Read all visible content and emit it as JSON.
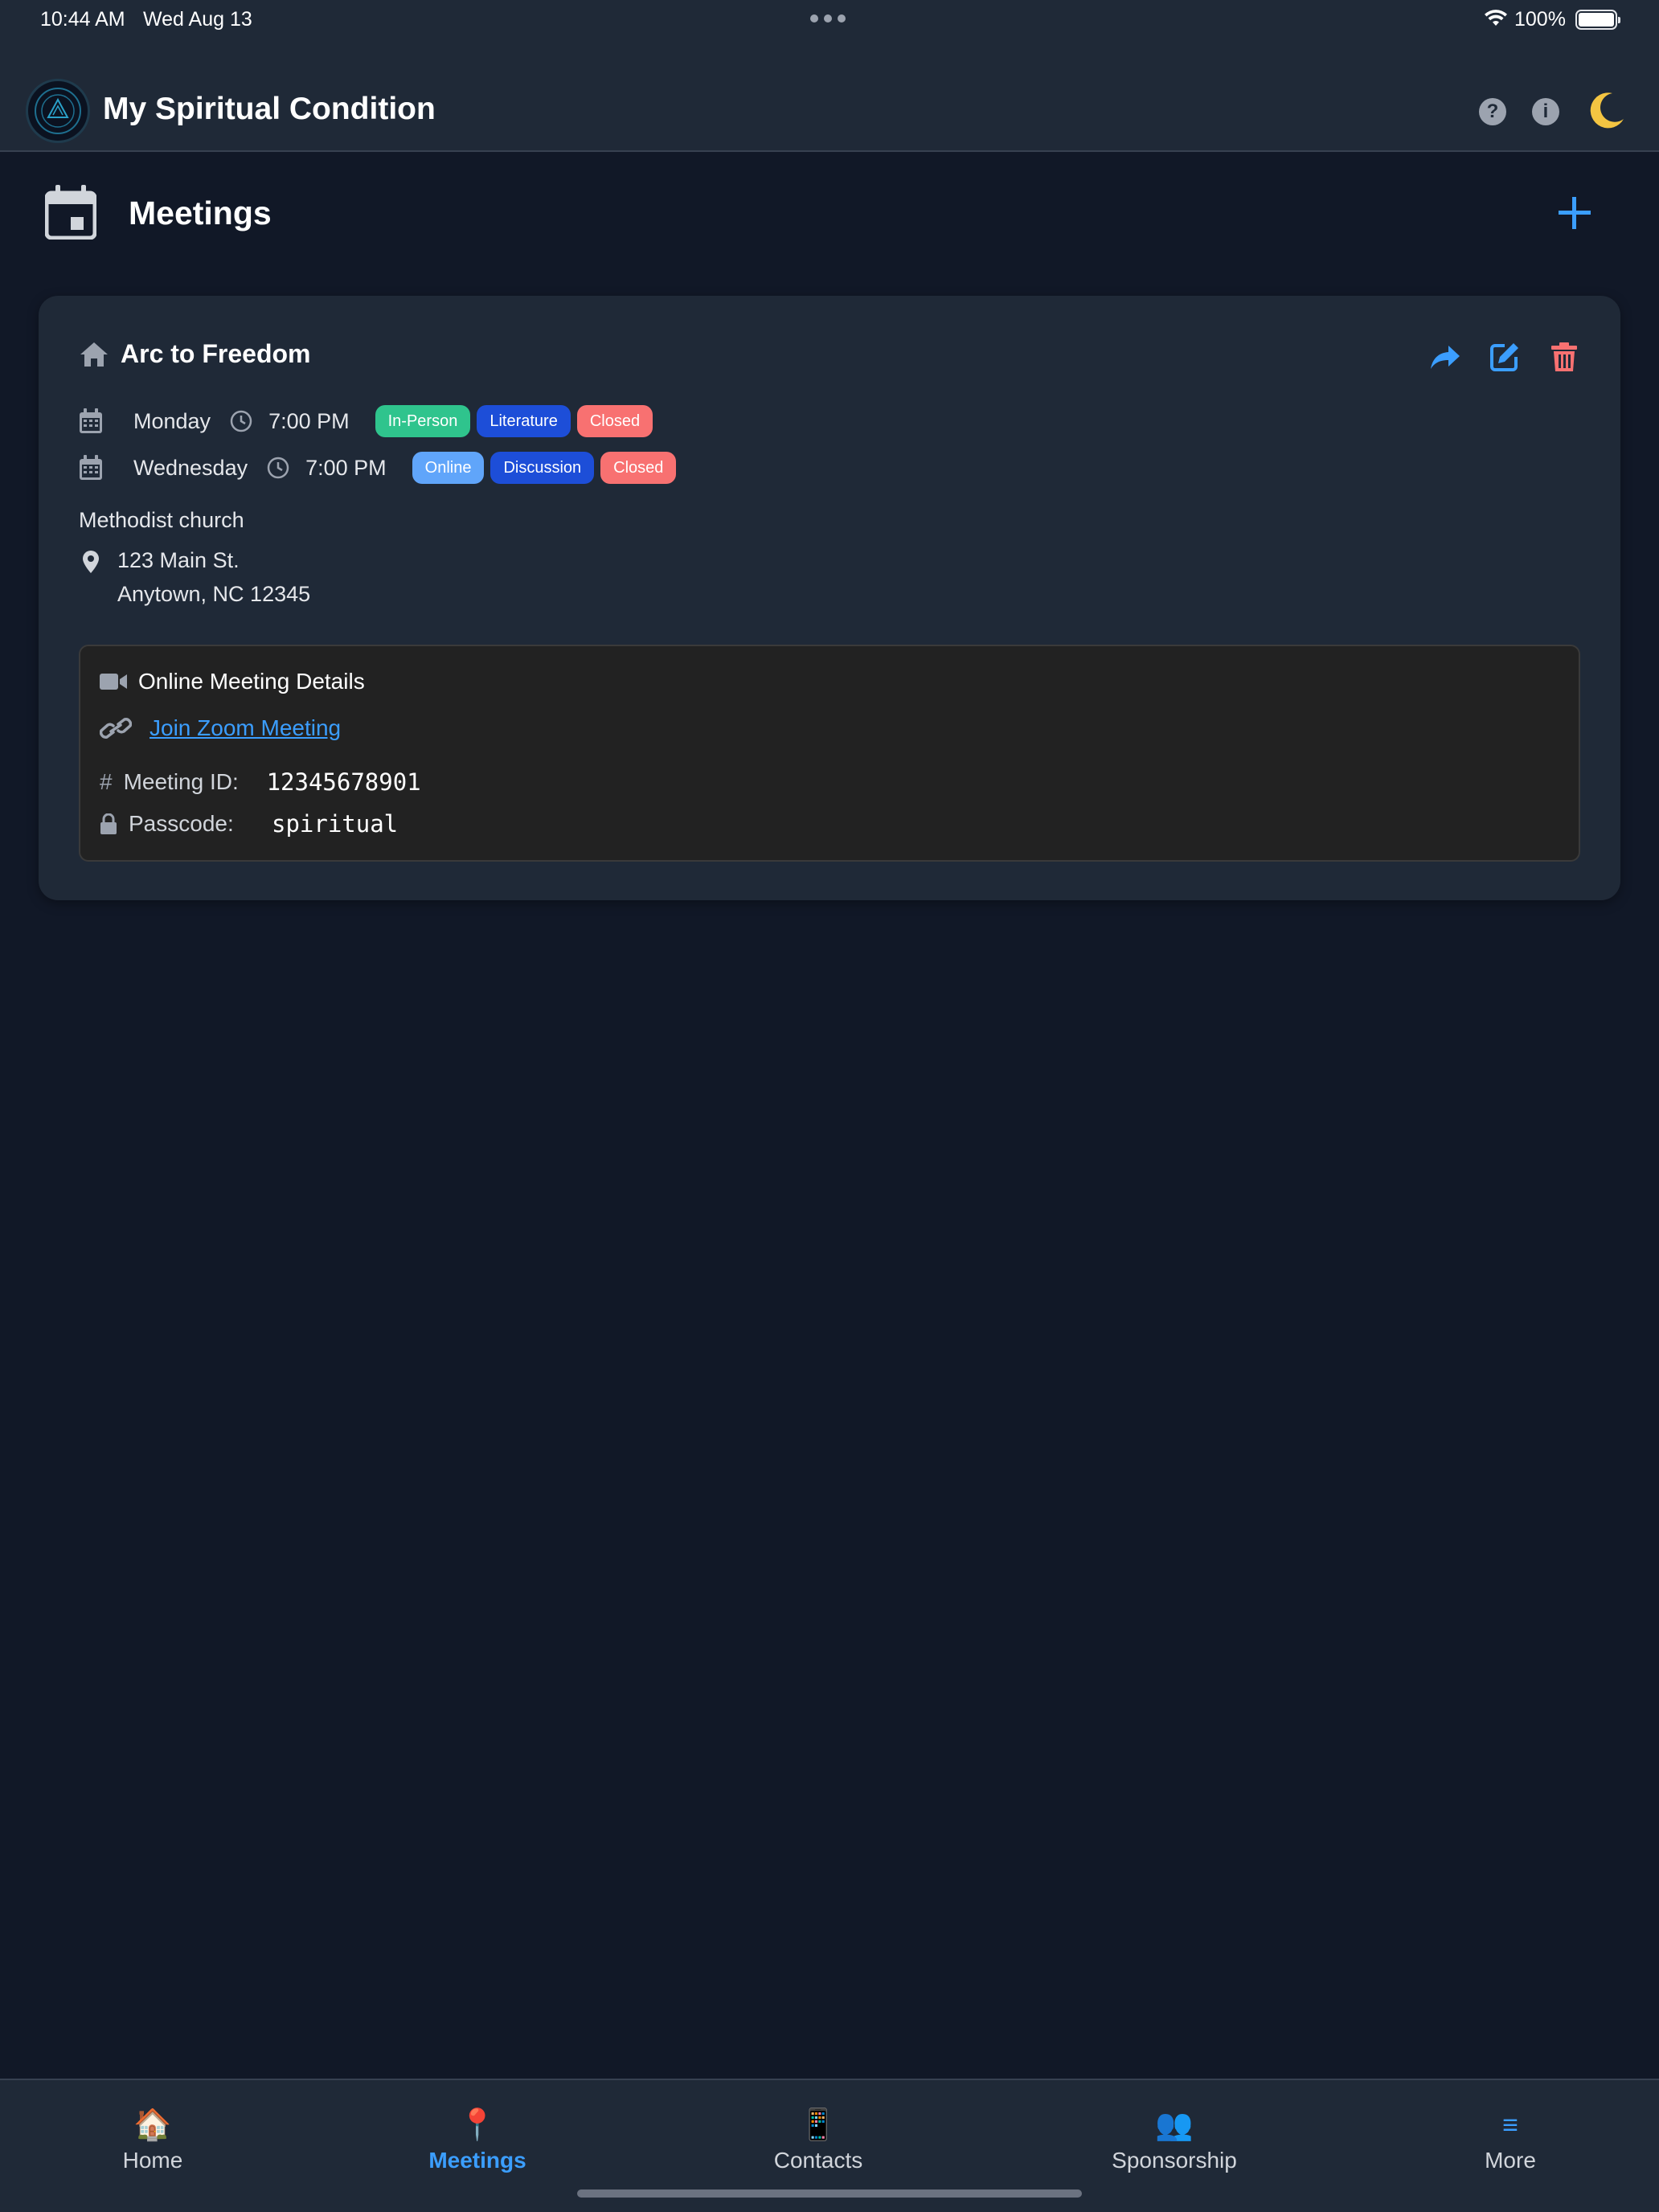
{
  "status_bar": {
    "time": "10:44 AM",
    "date": "Wed Aug 13",
    "battery": "100%"
  },
  "header": {
    "app_title": "My Spiritual Condition",
    "help_icon": "question-circle-icon",
    "info_icon": "info-circle-icon",
    "theme_icon": "moon-icon"
  },
  "page": {
    "title": "Meetings",
    "icon": "calendar-icon",
    "add_icon": "plus-icon"
  },
  "meeting": {
    "name": "Arc to Freedom",
    "schedules": [
      {
        "day": "Monday",
        "time": "7:00 PM",
        "badges": [
          {
            "label": "In-Person",
            "color": "#2fc48d"
          },
          {
            "label": "Literature",
            "color": "#1d4ed8"
          },
          {
            "label": "Closed",
            "color": "#f87171"
          }
        ]
      },
      {
        "day": "Wednesday",
        "time": "7:00 PM",
        "badges": [
          {
            "label": "Online",
            "color": "#60a5fa"
          },
          {
            "label": "Discussion",
            "color": "#1d4ed8"
          },
          {
            "label": "Closed",
            "color": "#f87171"
          }
        ]
      }
    ],
    "location_name": "Methodist church",
    "address_line1": "123 Main St.",
    "address_line2": "Anytown, NC 12345",
    "online": {
      "heading": "Online Meeting Details",
      "link_text": "Join Zoom Meeting",
      "meeting_id_label": "Meeting ID:",
      "meeting_id": "12345678901",
      "passcode_label": "Passcode:",
      "passcode": "spiritual"
    }
  },
  "tabs": [
    {
      "label": "Home",
      "icon": "🏠"
    },
    {
      "label": "Meetings",
      "icon": "📍"
    },
    {
      "label": "Contacts",
      "icon": "📱"
    },
    {
      "label": "Sponsorship",
      "icon": "👥"
    },
    {
      "label": "More",
      "icon": "≡"
    }
  ],
  "colors": {
    "background": "#111827",
    "surface": "#1f2937",
    "accent": "#3b9eff",
    "danger": "#f87171"
  }
}
